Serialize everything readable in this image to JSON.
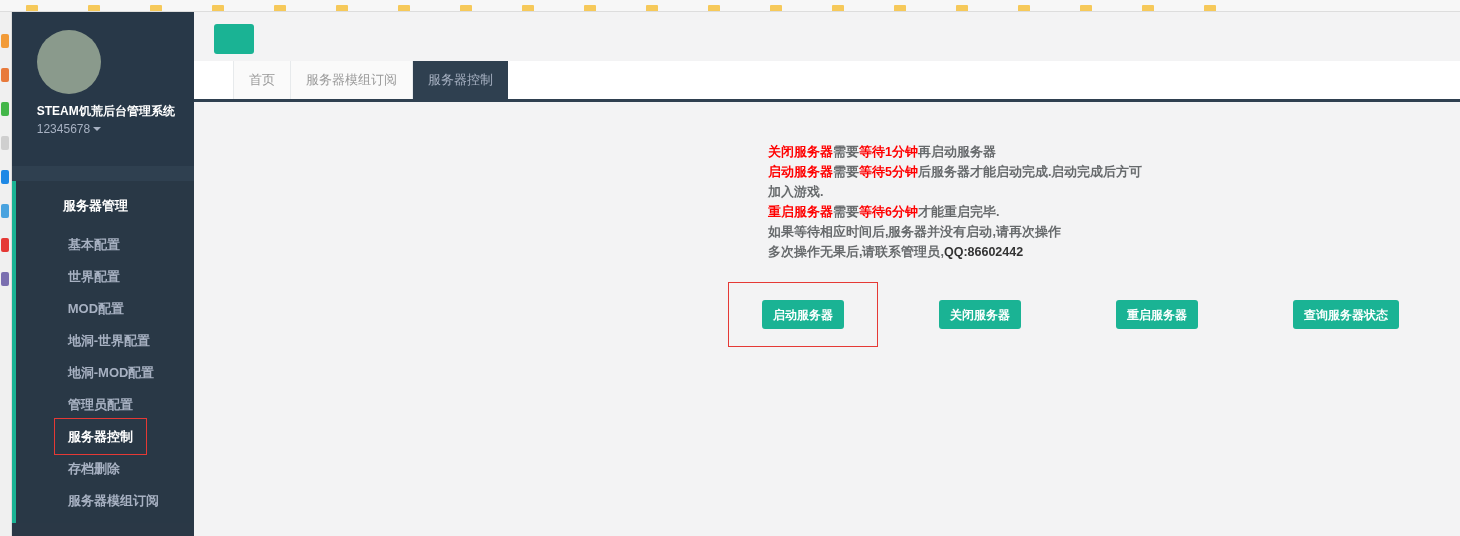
{
  "sidebar": {
    "title": "STEAM饥荒后台管理系统",
    "account": "12345678",
    "section": "服务器管理",
    "items": [
      {
        "label": "基本配置",
        "selected": false,
        "annotated": false
      },
      {
        "label": "世界配置",
        "selected": false,
        "annotated": false
      },
      {
        "label": "MOD配置",
        "selected": false,
        "annotated": false
      },
      {
        "label": "地洞-世界配置",
        "selected": false,
        "annotated": false
      },
      {
        "label": "地洞-MOD配置",
        "selected": false,
        "annotated": false
      },
      {
        "label": "管理员配置",
        "selected": false,
        "annotated": false
      },
      {
        "label": "服务器控制",
        "selected": true,
        "annotated": true
      },
      {
        "label": "存档删除",
        "selected": false,
        "annotated": false
      },
      {
        "label": "服务器模组订阅",
        "selected": false,
        "annotated": false
      }
    ]
  },
  "tabs": [
    {
      "label": "首页",
      "selected": false
    },
    {
      "label": "服务器模组订阅",
      "selected": false
    },
    {
      "label": "服务器控制",
      "selected": true
    }
  ],
  "notice": [
    [
      {
        "kind": "red",
        "text": "关闭服务器"
      },
      {
        "kind": "plain",
        "text": "需要"
      },
      {
        "kind": "red",
        "text": "等待1分钟"
      },
      {
        "kind": "plain",
        "text": "再启动服务器"
      }
    ],
    [
      {
        "kind": "red",
        "text": "启动服务器"
      },
      {
        "kind": "plain",
        "text": "需要"
      },
      {
        "kind": "red",
        "text": "等待5分钟"
      },
      {
        "kind": "plain",
        "text": "后服务器才能启动完成.启动完成后方可加入游戏."
      }
    ],
    [
      {
        "kind": "red",
        "text": "重启服务器"
      },
      {
        "kind": "plain",
        "text": "需要"
      },
      {
        "kind": "red",
        "text": "等待6分钟"
      },
      {
        "kind": "plain",
        "text": "才能重启完毕."
      }
    ],
    [
      {
        "kind": "plain",
        "text": "如果等待相应时间后,服务器并没有启动,请再次操作"
      }
    ],
    [
      {
        "kind": "plain",
        "text": "多次操作无果后,请联系管理员,"
      },
      {
        "kind": "strong",
        "text": "QQ:86602442"
      }
    ]
  ],
  "actions": [
    {
      "label": "启动服务器",
      "annotated": true
    },
    {
      "label": "关闭服务器",
      "annotated": false
    },
    {
      "label": "重启服务器",
      "annotated": false
    },
    {
      "label": "查询服务器状态",
      "annotated": false
    }
  ]
}
